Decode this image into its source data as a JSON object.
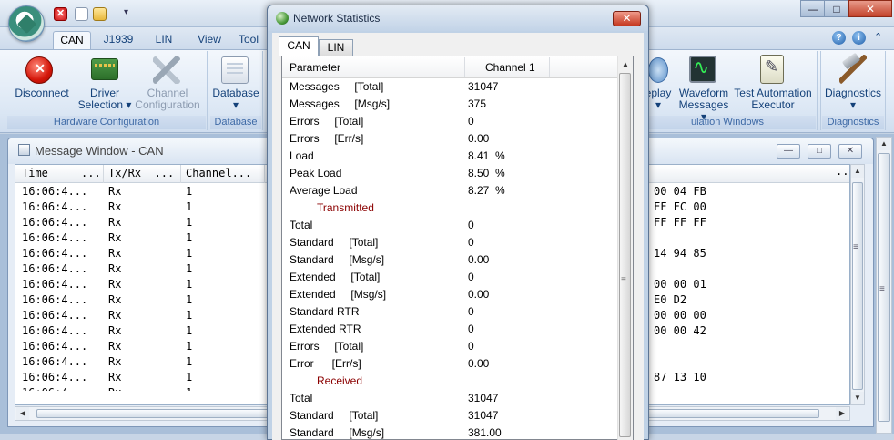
{
  "title_bar": {
    "close_glyph": "✕",
    "more_glyph": "▾",
    "min_glyph": "—",
    "max_glyph": "□",
    "close_window_glyph": "✕"
  },
  "ribbon_tabs": [
    "CAN",
    "J1939",
    "LIN",
    "View",
    "Tool"
  ],
  "help_glyph": "?",
  "info_glyph": "i",
  "collapse_glyph": "⌃",
  "ribbon_groups": {
    "hardware_configuration": {
      "label": "Hardware Configuration",
      "disconnect": "Disconnect",
      "driver_selection": [
        "Driver",
        "Selection ▾"
      ],
      "channel_configuration": [
        "Channel",
        "Configuration"
      ]
    },
    "database": {
      "label": "Database",
      "button": "Database",
      "dropdown": "▾"
    },
    "simulation_windows": {
      "label": "ulation Windows",
      "replay": [
        "eplay",
        "▾"
      ],
      "waveform": [
        "Waveform",
        "Messages ▾"
      ],
      "test_automation": [
        "Test Automation",
        "Executor"
      ]
    },
    "diagnostics": {
      "label": "Diagnostics",
      "button": "Diagnostics",
      "dropdown": "▾"
    }
  },
  "message_window": {
    "title": "Message Window - CAN",
    "columns": [
      "Time     ...",
      "Tx/Rx  ...",
      "Channel..."
    ],
    "right_header_glyph": "..",
    "rows": [
      {
        "time": "16:06:4...",
        "txrx": "Rx",
        "channel": "1",
        "data": "00 04 FB"
      },
      {
        "time": "16:06:4...",
        "txrx": "Rx",
        "channel": "1",
        "data": "FF FC 00"
      },
      {
        "time": "16:06:4...",
        "txrx": "Rx",
        "channel": "1",
        "data": "FF FF FF"
      },
      {
        "time": "16:06:4...",
        "txrx": "Rx",
        "channel": "1",
        "data": ""
      },
      {
        "time": "16:06:4...",
        "txrx": "Rx",
        "channel": "1",
        "data": "14 94 85"
      },
      {
        "time": "16:06:4...",
        "txrx": "Rx",
        "channel": "1",
        "data": ""
      },
      {
        "time": "16:06:4...",
        "txrx": "Rx",
        "channel": "1",
        "data": "00 00 01"
      },
      {
        "time": "16:06:4...",
        "txrx": "Rx",
        "channel": "1",
        "data": "E0 D2"
      },
      {
        "time": "16:06:4...",
        "txrx": "Rx",
        "channel": "1",
        "data": "00 00 00"
      },
      {
        "time": "16:06:4...",
        "txrx": "Rx",
        "channel": "1",
        "data": "00 00 42"
      },
      {
        "time": "16:06:4...",
        "txrx": "Rx",
        "channel": "1",
        "data": ""
      },
      {
        "time": "16:06:4...",
        "txrx": "Rx",
        "channel": "1",
        "data": ""
      },
      {
        "time": "16:06:4...",
        "txrx": "Rx",
        "channel": "1",
        "data": "87 13 10"
      }
    ],
    "partial_row": {
      "time": "16:06:4...",
      "txrx": "Rx",
      "channel": "1"
    },
    "scroll_up": "▲",
    "scroll_down": "▼",
    "scroll_left": "◀",
    "scroll_right": "▶",
    "grip": "≡"
  },
  "network_statistics": {
    "title": "Network Statistics",
    "close": "✕",
    "tabs": [
      "CAN",
      "LIN"
    ],
    "columns": [
      "Parameter",
      "Channel 1"
    ],
    "rows": [
      {
        "param": "Messages     [Total]",
        "value": "31047"
      },
      {
        "param": "Messages     [Msg/s]",
        "value": "375"
      },
      {
        "param": "Errors     [Total]",
        "value": "0"
      },
      {
        "param": "Errors     [Err/s]",
        "value": "0.00"
      },
      {
        "param": "Load",
        "value": "8.41  %"
      },
      {
        "param": "Peak Load",
        "value": "8.50  %"
      },
      {
        "param": "Average Load",
        "value": "8.27  %"
      },
      {
        "section": "Transmitted"
      },
      {
        "param": "Total",
        "value": "0"
      },
      {
        "param": "Standard     [Total]",
        "value": "0"
      },
      {
        "param": "Standard     [Msg/s]",
        "value": "0.00"
      },
      {
        "param": "Extended     [Total]",
        "value": "0"
      },
      {
        "param": "Extended     [Msg/s]",
        "value": "0.00"
      },
      {
        "param": "Standard RTR",
        "value": "0"
      },
      {
        "param": "Extended RTR",
        "value": "0"
      },
      {
        "param": "Errors     [Total]",
        "value": "0"
      },
      {
        "param": "Error      [Err/s]",
        "value": "0.00"
      },
      {
        "section": "Received"
      },
      {
        "param": "Total",
        "value": "31047"
      },
      {
        "param": "Standard     [Total]",
        "value": "31047"
      },
      {
        "param": "Standard     [Msg/s]",
        "value": "381.00"
      }
    ],
    "scroll_up": "▲",
    "grip": "≡"
  }
}
